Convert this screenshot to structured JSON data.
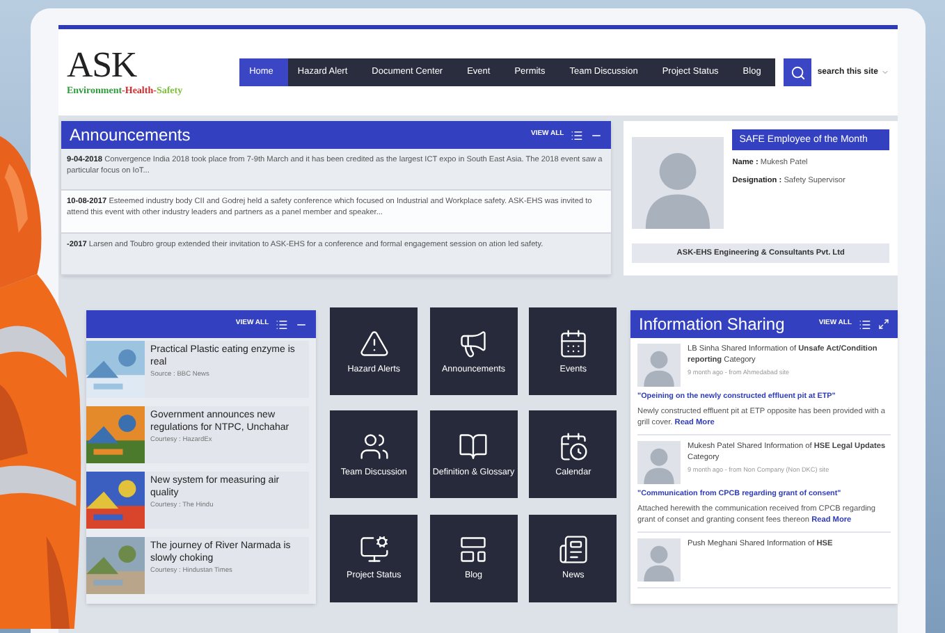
{
  "header": {
    "logo": {
      "mark": "ASK",
      "tagline": [
        {
          "text": "Environment",
          "color": "#2e9b3a"
        },
        {
          "text": "-Health-",
          "color": "#d02a2a"
        },
        {
          "text": "Safety",
          "color": "#7cbf3a"
        }
      ]
    },
    "nav": [
      {
        "label": "Home",
        "selected": true
      },
      {
        "label": "Hazard Alert",
        "selected": false
      },
      {
        "label": "Document Center",
        "selected": false
      },
      {
        "label": "Event",
        "selected": false
      },
      {
        "label": "Permits",
        "selected": false
      },
      {
        "label": "Team Discussion",
        "selected": false
      },
      {
        "label": "Project Status",
        "selected": false
      },
      {
        "label": "Blog",
        "selected": false
      }
    ],
    "search": {
      "placeholder": "search this site"
    }
  },
  "announcements": {
    "title": "Announcements",
    "view_all": "VIEW ALL",
    "items": [
      {
        "date": "9-04-2018",
        "text": "Convergence India 2018 took place from 7-9th March and it has been credited as the largest ICT expo in South East Asia. The 2018 event saw a particular focus on IoT...",
        "highlighted": false
      },
      {
        "date": "10-08-2017",
        "text": "Esteemed industry body CII and Godrej held a safety conference which focused on Industrial and Workplace safety. ASK-EHS was invited to attend this event with other industry leaders and partners as a panel member and speaker...",
        "highlighted": true
      },
      {
        "date": "-2017",
        "text": "Larsen and Toubro group extended their invitation to ASK-EHS for a conference and formal engagement session on ation led safety.",
        "highlighted": false
      }
    ]
  },
  "employee": {
    "title": "SAFE Employee of the Month",
    "name_label": "Name :",
    "name": "Mukesh Patel",
    "designation_label": "Designation :",
    "designation": "Safety Supervisor",
    "company": "ASK-EHS Engineering & Consultants Pvt. Ltd"
  },
  "news": {
    "view_all": "VIEW ALL",
    "items": [
      {
        "title": "Practical Plastic eating enzyme is real",
        "source": "Source : BBC News"
      },
      {
        "title": "Government announces new regulations for NTPC, Unchahar",
        "source": "Courtesy : HazardEx"
      },
      {
        "title": "New system for measuring air quality",
        "source": "Courtesy : The Hindu"
      },
      {
        "title": "The journey of River Narmada is slowly choking",
        "source": "Courtesy : Hindustan Times"
      }
    ]
  },
  "tiles": [
    {
      "label": "Hazard Alerts"
    },
    {
      "label": "Announcements"
    },
    {
      "label": "Events"
    },
    {
      "label": "Team Discussion"
    },
    {
      "label": "Definition & Glossary"
    },
    {
      "label": "Calendar"
    },
    {
      "label": "Project Status"
    },
    {
      "label": "Blog"
    },
    {
      "label": "News"
    }
  ],
  "info_sharing": {
    "title": "Information Sharing",
    "view_all": "VIEW ALL",
    "posts": [
      {
        "sentence": "LB Sinha Shared Information of **Unsafe Act/Condition reporting** Category",
        "meta": "9 month ago - from Ahmedabad site",
        "headline": "\"Opeining on the newly constructed effluent pit at ETP\"",
        "body": "Newly constructed effluent pit at ETP opposite has been provided with a grill cover.",
        "more": "Read More"
      },
      {
        "sentence": "Mukesh Patel Shared Information of **HSE Legal Updates** Category",
        "meta": "9 month ago - from Non Company (Non DKC) site",
        "headline": "\"Communication from CPCB regarding grant of consent\"",
        "body": "Attached herewith the communication received from CPCB regarding grant of conset and granting consent fees thereon",
        "more": "Read More"
      },
      {
        "sentence": "Push Meghani Shared Information of **HSE**"
      }
    ]
  }
}
